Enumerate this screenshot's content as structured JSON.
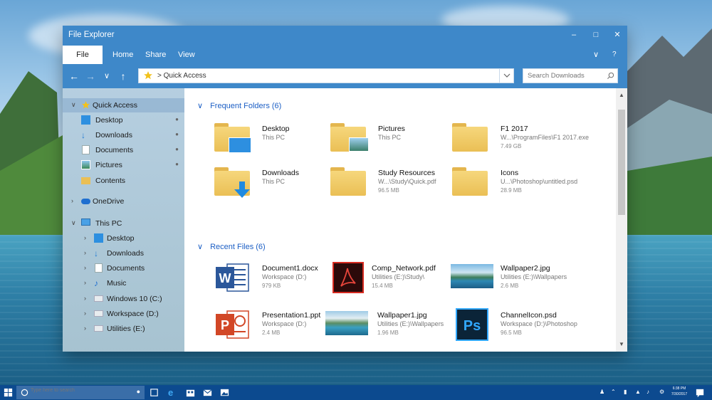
{
  "window": {
    "title": "File Explorer"
  },
  "ribbon": {
    "tabs": [
      "File",
      "Home",
      "Share",
      "View"
    ]
  },
  "address": {
    "path": "> Quick Access",
    "search_placeholder": "Search Downloads"
  },
  "sidebar": {
    "items": [
      {
        "label": "Quick Access",
        "icon": "star-icon"
      },
      {
        "label": "Desktop",
        "icon": "desktop-icon",
        "pinned": true
      },
      {
        "label": "Downloads",
        "icon": "download-icon",
        "pinned": true
      },
      {
        "label": "Documents",
        "icon": "document-icon",
        "pinned": true
      },
      {
        "label": "Pictures",
        "icon": "picture-icon",
        "pinned": true
      },
      {
        "label": "Contents",
        "icon": "folder-icon"
      },
      {
        "label": "OneDrive",
        "icon": "cloud-icon"
      },
      {
        "label": "This PC",
        "icon": "computer-icon"
      },
      {
        "label": "Desktop",
        "icon": "desktop-icon"
      },
      {
        "label": "Downloads",
        "icon": "download-icon"
      },
      {
        "label": "Documents",
        "icon": "document-icon"
      },
      {
        "label": "Music",
        "icon": "music-icon"
      },
      {
        "label": "Windows 10 (C:)",
        "icon": "drive-icon"
      },
      {
        "label": "Workspace (D:)",
        "icon": "drive-icon"
      },
      {
        "label": "Utilities (E:)",
        "icon": "drive-icon"
      }
    ]
  },
  "frequent": {
    "heading": "Frequent Folders (6)",
    "items": [
      {
        "name": "Desktop",
        "location": "This PC",
        "size": ""
      },
      {
        "name": "Pictures",
        "location": "This PC",
        "size": ""
      },
      {
        "name": "F1 2017",
        "location": "W...\\ProgramFiles\\F1 2017.exe",
        "size": "7.49 GB"
      },
      {
        "name": "Downloads",
        "location": "This PC",
        "size": ""
      },
      {
        "name": "Study Resources",
        "location": "W...\\Study\\Quick.pdf",
        "size": "96.5 MB"
      },
      {
        "name": "Icons",
        "location": "U...\\Photoshop\\untitled.psd",
        "size": "28.9 MB"
      }
    ]
  },
  "recent": {
    "heading": "Recent Files (6)",
    "items": [
      {
        "name": "Document1.docx",
        "location": "Workspace (D:)",
        "size": "979 KB"
      },
      {
        "name": "Comp_Network.pdf",
        "location": "Utilities (E:)\\Study\\",
        "size": "15.4 MB"
      },
      {
        "name": "Wallpaper2.jpg",
        "location": "Utilities (E:)\\Wallpapers",
        "size": "2.6 MB"
      },
      {
        "name": "Presentation1.ppt",
        "location": "Workspace (D:)",
        "size": "2.4 MB"
      },
      {
        "name": "Wallpaper1.jpg",
        "location": "Utilities (E:)\\Wallpapers",
        "size": "1.96 MB"
      },
      {
        "name": "ChannelIcon.psd",
        "location": "Workspace (D:)\\Photoshop",
        "size": "96.5 MB"
      }
    ]
  },
  "taskbar": {
    "search_placeholder": "Type here to search",
    "time": "6:38 PM",
    "date": "7/30/2017"
  },
  "colors": {
    "accent": "#3e88c9",
    "link": "#1c5fc5",
    "taskbar": "#0c4a8f"
  }
}
